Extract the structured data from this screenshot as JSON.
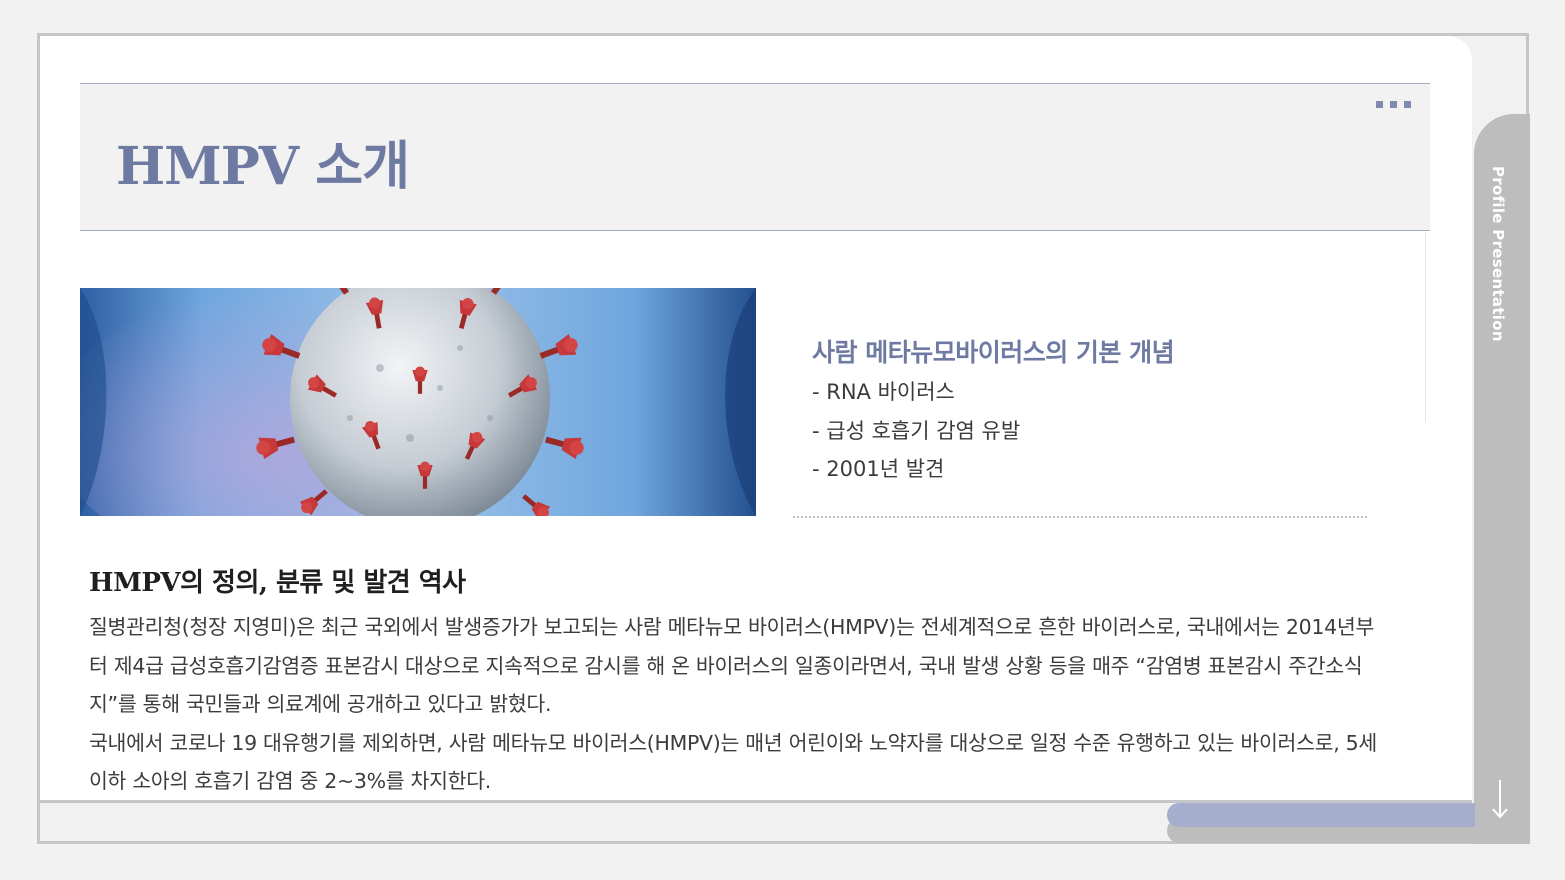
{
  "slide": {
    "title": "HMPV 소개",
    "side_label": "Profile Presentation"
  },
  "concept": {
    "heading": "사람 메타뉴모바이러스의 기본 개념",
    "items": [
      "- RNA 바이러스",
      "- 급성 호흡기 감염 유발",
      "- 2001년 발견"
    ]
  },
  "section": {
    "heading": "HMPV의 정의, 분류 및 발견 역사",
    "body": " 질병관리청(청장 지영미)은 최근 국외에서 발생증가가 보고되는 사람 메타뉴모 바이러스(HMPV)는 전세계적으로 흔한 바이러스로, 국내에서는 2014년부터 제4급 급성호흡기감염증 표본감시 대상으로 지속적으로 감시를 해 온 바이러스의 일종이라면서, 국내 발생 상황 등을 매주 “감염병 표본감시 주간소식지”를 통해 국민들과 의료계에 공개하고 있다고 밝혔다.\n 국내에서 코로나 19 대유행기를 제외하면, 사람 메타뉴모 바이러스(HMPV)는 매년 어린이와 노약자를 대상으로 일정 수준 유행하고 있는 바이러스로, 5세 이하 소아의 호흡기 감염 중 2~3%를 차지한다."
  },
  "colors": {
    "accent": "#6e7aa2",
    "title_band": "#f2f2f2",
    "side_tab": "#bdbdbd",
    "bottom_tab": "#a6aecd",
    "virus_spike": "#c0312f",
    "virus_body": "#c9d0d6",
    "image_background": "#1f4f8f"
  },
  "icons": {
    "more": "dots-icon",
    "down": "down-arrow-icon"
  }
}
